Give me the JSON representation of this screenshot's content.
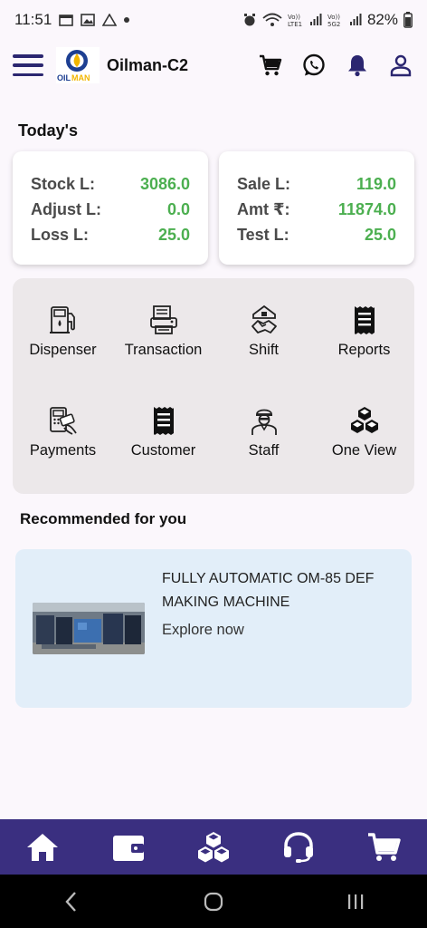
{
  "status_bar": {
    "time": "11:51",
    "battery": "82%"
  },
  "header": {
    "app_title": "Oilman-C2",
    "logo_text": "OILMAN",
    "icons": [
      "menu-icon",
      "cart-icon",
      "whatsapp-icon",
      "bell-icon",
      "user-icon"
    ]
  },
  "today": {
    "title": "Today's",
    "left_card": [
      {
        "label": "Stock L:",
        "value": "3086.0"
      },
      {
        "label": "Adjust L:",
        "value": "0.0"
      },
      {
        "label": "Loss L:",
        "value": "25.0"
      }
    ],
    "right_card": [
      {
        "label": "Sale L:",
        "value": "119.0"
      },
      {
        "label": "Amt ₹:",
        "value": "11874.0"
      },
      {
        "label": "Test L:",
        "value": "25.0"
      }
    ]
  },
  "menu": [
    {
      "label": "Dispenser",
      "icon": "fuel-pump-icon"
    },
    {
      "label": "Transaction",
      "icon": "receipt-printer-icon"
    },
    {
      "label": "Shift",
      "icon": "handshake-icon"
    },
    {
      "label": "Reports",
      "icon": "receipt-icon"
    },
    {
      "label": "Payments",
      "icon": "card-payment-icon"
    },
    {
      "label": "Customer",
      "icon": "receipt-icon"
    },
    {
      "label": "Staff",
      "icon": "staff-icon"
    },
    {
      "label": "One View",
      "icon": "cubes-icon"
    }
  ],
  "recommended": {
    "title": "Recommended for you",
    "card_title": "FULLY AUTOMATIC OM-85 DEF MAKING MACHINE",
    "link": "Explore now"
  },
  "bottom_nav": [
    "home-icon",
    "wallet-icon",
    "cubes-icon",
    "headset-icon",
    "cart-icon"
  ],
  "colors": {
    "brand": "#3a2f80",
    "value_green": "#4caf50",
    "panel": "#ece8ea",
    "reco_bg": "#e2eef9"
  }
}
